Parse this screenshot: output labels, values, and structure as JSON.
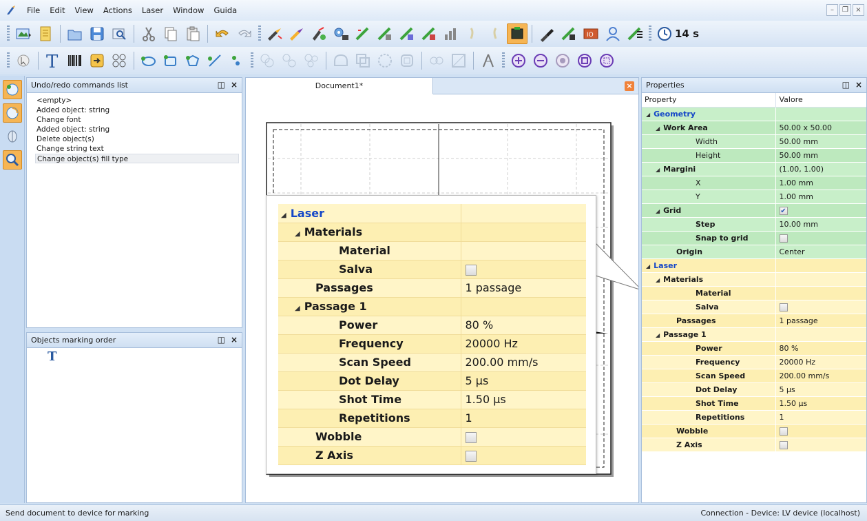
{
  "menu": {
    "items": [
      "File",
      "Edit",
      "View",
      "Actions",
      "Laser",
      "Window",
      "Guida"
    ]
  },
  "toolbar": {
    "timer_label": "14 s"
  },
  "undo_panel": {
    "title": "Undo/redo commands list",
    "items": [
      "<empty>",
      "Added object: string",
      "Change font",
      "Added object: string",
      "Delete object(s)",
      "Change string text",
      "Change object(s) fill type"
    ],
    "selected_index": 6
  },
  "order_panel": {
    "title": "Objects marking order",
    "item_glyph": "T"
  },
  "document": {
    "tab_label": "Document1*"
  },
  "callout": {
    "rows": [
      {
        "label": "Laser",
        "value": "",
        "kind": "category",
        "indent": 0
      },
      {
        "label": "Materials",
        "value": "",
        "kind": "group",
        "indent": 1
      },
      {
        "label": "Material",
        "value": "",
        "kind": "prop",
        "indent": 3
      },
      {
        "label": "Salva",
        "value": "",
        "kind": "checkbox",
        "indent": 3
      },
      {
        "label": "Passages",
        "value": "1 passage",
        "kind": "prop",
        "indent": 2
      },
      {
        "label": "Passage 1",
        "value": "",
        "kind": "group",
        "indent": 1
      },
      {
        "label": "Power",
        "value": "80 %",
        "kind": "prop",
        "indent": 3
      },
      {
        "label": "Frequency",
        "value": "20000 Hz",
        "kind": "prop",
        "indent": 3
      },
      {
        "label": "Scan Speed",
        "value": "200.00 mm/s",
        "kind": "prop",
        "indent": 3
      },
      {
        "label": "Dot Delay",
        "value": "5 µs",
        "kind": "prop",
        "indent": 3
      },
      {
        "label": "Shot Time",
        "value": "1.50 µs",
        "kind": "prop",
        "indent": 3
      },
      {
        "label": "Repetitions",
        "value": "1",
        "kind": "prop",
        "indent": 3
      },
      {
        "label": "Wobble",
        "value": "",
        "kind": "checkbox",
        "indent": 2
      },
      {
        "label": "Z Axis",
        "value": "",
        "kind": "checkbox",
        "indent": 2
      }
    ]
  },
  "properties": {
    "title": "Properties",
    "col_property": "Property",
    "col_value": "Valore",
    "rows": [
      {
        "label": "Geometry",
        "value": "",
        "section": "geo",
        "kind": "category",
        "indent": 0,
        "bold": true
      },
      {
        "label": "Work Area",
        "value": "50.00 x 50.00",
        "section": "geo",
        "kind": "group",
        "indent": 1,
        "bold": true
      },
      {
        "label": "Width",
        "value": "50.00 mm",
        "section": "geo",
        "kind": "prop",
        "indent": 3,
        "bold": false
      },
      {
        "label": "Height",
        "value": "50.00 mm",
        "section": "geo",
        "kind": "prop",
        "indent": 3,
        "bold": false
      },
      {
        "label": "Margini",
        "value": "(1.00, 1.00)",
        "section": "geo",
        "kind": "group",
        "indent": 1,
        "bold": true
      },
      {
        "label": "X",
        "value": "1.00 mm",
        "section": "geo",
        "kind": "prop",
        "indent": 3,
        "bold": false
      },
      {
        "label": "Y",
        "value": "1.00 mm",
        "section": "geo",
        "kind": "prop",
        "indent": 3,
        "bold": false
      },
      {
        "label": "Grid",
        "value": "",
        "section": "geo",
        "kind": "group-checkbox",
        "indent": 1,
        "bold": true,
        "checked": true
      },
      {
        "label": "Step",
        "value": "10.00 mm",
        "section": "geo",
        "kind": "prop",
        "indent": 3,
        "bold": true
      },
      {
        "label": "Snap to grid",
        "value": "",
        "section": "geo",
        "kind": "checkbox",
        "indent": 3,
        "bold": true,
        "checked": false
      },
      {
        "label": "Origin",
        "value": "Center",
        "section": "geo",
        "kind": "prop",
        "indent": 2,
        "bold": true
      },
      {
        "label": "Laser",
        "value": "",
        "section": "las",
        "kind": "category",
        "indent": 0,
        "bold": true
      },
      {
        "label": "Materials",
        "value": "",
        "section": "las",
        "kind": "group",
        "indent": 1,
        "bold": true
      },
      {
        "label": "Material",
        "value": "",
        "section": "las",
        "kind": "prop",
        "indent": 3,
        "bold": true
      },
      {
        "label": "Salva",
        "value": "",
        "section": "las",
        "kind": "checkbox",
        "indent": 3,
        "bold": true,
        "checked": false
      },
      {
        "label": "Passages",
        "value": "1 passage",
        "section": "las",
        "kind": "prop",
        "indent": 2,
        "bold": true
      },
      {
        "label": "Passage 1",
        "value": "",
        "section": "las",
        "kind": "group",
        "indent": 1,
        "bold": true
      },
      {
        "label": "Power",
        "value": "80 %",
        "section": "las",
        "kind": "prop",
        "indent": 3,
        "bold": true
      },
      {
        "label": "Frequency",
        "value": "20000 Hz",
        "section": "las",
        "kind": "prop",
        "indent": 3,
        "bold": true
      },
      {
        "label": "Scan Speed",
        "value": "200.00 mm/s",
        "section": "las",
        "kind": "prop",
        "indent": 3,
        "bold": true
      },
      {
        "label": "Dot Delay",
        "value": "5 µs",
        "section": "las",
        "kind": "prop",
        "indent": 3,
        "bold": true
      },
      {
        "label": "Shot Time",
        "value": "1.50 µs",
        "section": "las",
        "kind": "prop",
        "indent": 3,
        "bold": true
      },
      {
        "label": "Repetitions",
        "value": "1",
        "section": "las",
        "kind": "prop",
        "indent": 3,
        "bold": true
      },
      {
        "label": "Wobble",
        "value": "",
        "section": "las",
        "kind": "checkbox",
        "indent": 2,
        "bold": true,
        "checked": false
      },
      {
        "label": "Z Axis",
        "value": "",
        "section": "las",
        "kind": "checkbox",
        "indent": 2,
        "bold": true,
        "checked": false
      }
    ]
  },
  "statusbar": {
    "left": "Send document to device for marking",
    "right": "Connection - Device: LV device (localhost)"
  },
  "colors": {
    "category_text": "#1446c8",
    "geometry_row": "#c8efc9",
    "laser_row": "#fff5c8",
    "active_tool": "#f6b554"
  }
}
